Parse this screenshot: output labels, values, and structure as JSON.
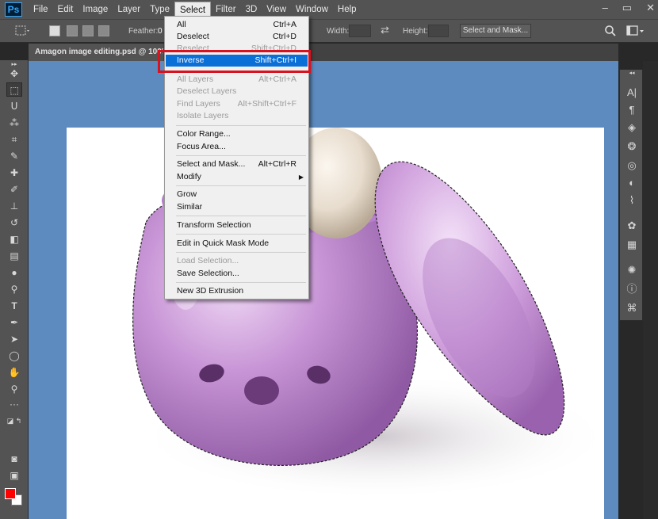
{
  "app": {
    "logo": "Ps"
  },
  "menubar": {
    "items": [
      "File",
      "Edit",
      "Image",
      "Layer",
      "Type",
      "Select",
      "Filter",
      "3D",
      "View",
      "Window",
      "Help"
    ],
    "active": "Select"
  },
  "window_controls": {
    "minimize": "–",
    "restore": "▭",
    "close": "✕"
  },
  "options": {
    "feather_label": "Feather:",
    "feather_value": "0",
    "width_label": "Width:",
    "height_label": "Height:",
    "select_mask_button": "Select and Mask..."
  },
  "document": {
    "tab_title": "Amagon image editing.psd @ 100% ("
  },
  "select_menu": {
    "all": {
      "label": "All",
      "shortcut": "Ctrl+A"
    },
    "deselect": {
      "label": "Deselect",
      "shortcut": "Ctrl+D"
    },
    "reselect": {
      "label": "Reselect",
      "shortcut": "Shift+Ctrl+D"
    },
    "inverse": {
      "label": "Inverse",
      "shortcut": "Shift+Ctrl+I"
    },
    "all_layers": {
      "label": "All Layers",
      "shortcut": "Alt+Ctrl+A"
    },
    "deselect_layers": {
      "label": "Deselect Layers"
    },
    "find_layers": {
      "label": "Find Layers",
      "shortcut": "Alt+Shift+Ctrl+F"
    },
    "isolate_layers": {
      "label": "Isolate Layers"
    },
    "color_range": {
      "label": "Color Range..."
    },
    "focus_area": {
      "label": "Focus Area..."
    },
    "select_and_mask": {
      "label": "Select and Mask...",
      "shortcut": "Alt+Ctrl+R"
    },
    "modify": {
      "label": "Modify"
    },
    "grow": {
      "label": "Grow"
    },
    "similar": {
      "label": "Similar"
    },
    "transform_selection": {
      "label": "Transform Selection"
    },
    "quick_mask": {
      "label": "Edit in Quick Mask Mode"
    },
    "load_selection": {
      "label": "Load Selection..."
    },
    "save_selection": {
      "label": "Save Selection..."
    },
    "new_3d_extrusion": {
      "label": "New 3D Extrusion"
    }
  },
  "colors": {
    "foreground": "#ff0000",
    "background": "#ffffff",
    "canvas_bg": "#5d8bbf",
    "highlight": "#0a70d8",
    "annotation_box": "#d8121e",
    "object": "#c48fd3"
  }
}
